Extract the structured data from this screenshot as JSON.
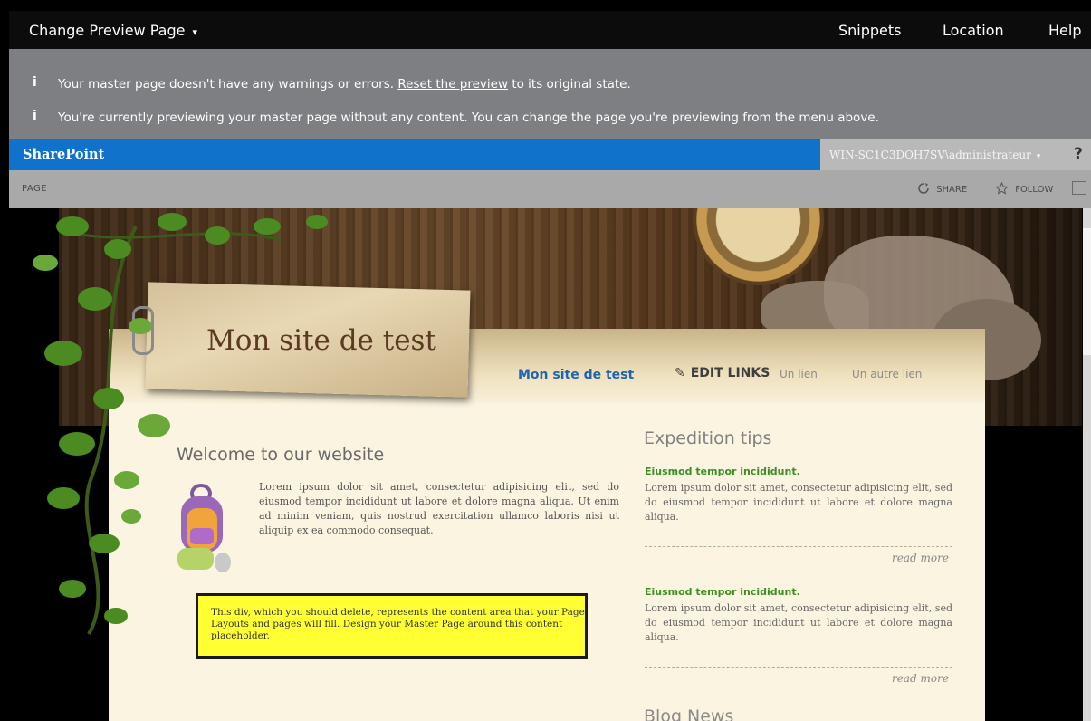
{
  "top_bar": {
    "change_preview": "Change Preview Page",
    "change_preview_caret": "▾",
    "snippets": "Snippets",
    "location": "Location",
    "help": "Help"
  },
  "messages": {
    "info_icon": "i",
    "line1_pre": "Your master page doesn't have any warnings or errors.",
    "line1_link": "Reset the preview",
    "line1_post": "to its original state.",
    "line2": "You're currently previewing your master page without any content. You can change the page you're previewing from the menu above."
  },
  "suite_bar": {
    "brand": "SharePoint",
    "user": "WIN-SC1C3DOH7SV\\administrateur",
    "user_caret": "▾",
    "help": "?"
  },
  "ribbon": {
    "page_tab": "PAGE",
    "share": "SHARE",
    "follow": "FOLLOW"
  },
  "site": {
    "title": "Mon site de test",
    "nav": {
      "home": "Mon site de test",
      "edit_links": "EDIT LINKS",
      "link1": "Un lien",
      "link2": "Un autre lien"
    },
    "welcome_title": "Welcome to our website",
    "welcome_text": "Lorem ipsum dolor sit amet, consectetur adipisicing elit, sed do eiusmod tempor incididunt ut labore et dolore magna aliqua. Ut enim ad minim veniam, quis nostrud exercitation ullamco laboris nisi ut aliquip ex ea commodo consequat.",
    "notice": "This div, which you should delete, represents the content area that your Page Layouts and pages will fill. Design your Master Page around this content placeholder.",
    "expedition_title": "Expedition tips",
    "tips": [
      {
        "title": "Eiusmod tempor incididunt.",
        "text": "Lorem ipsum dolor sit amet, consectetur adipisicing elit, sed do eiusmod tempor incididunt ut labore et dolore magna aliqua.",
        "read_more": "read more"
      },
      {
        "title": "Eiusmod tempor incididunt.",
        "text": "Lorem ipsum dolor sit amet, consectetur adipisicing elit, sed do eiusmod tempor incididunt ut labore et dolore magna aliqua.",
        "read_more": "read more"
      }
    ],
    "blog_title": "Blog News"
  },
  "colors": {
    "suite_blue": "#1172cb",
    "message_gray": "#7d7f83",
    "nav_blue": "#1f65b0",
    "tip_green": "#3d8f23",
    "notice_yellow": "#ffff33"
  },
  "icons": [
    "info-icon",
    "share-icon",
    "follow-star-icon",
    "focus-icon",
    "pencil-icon",
    "paperclip-icon",
    "backpack-icon"
  ]
}
